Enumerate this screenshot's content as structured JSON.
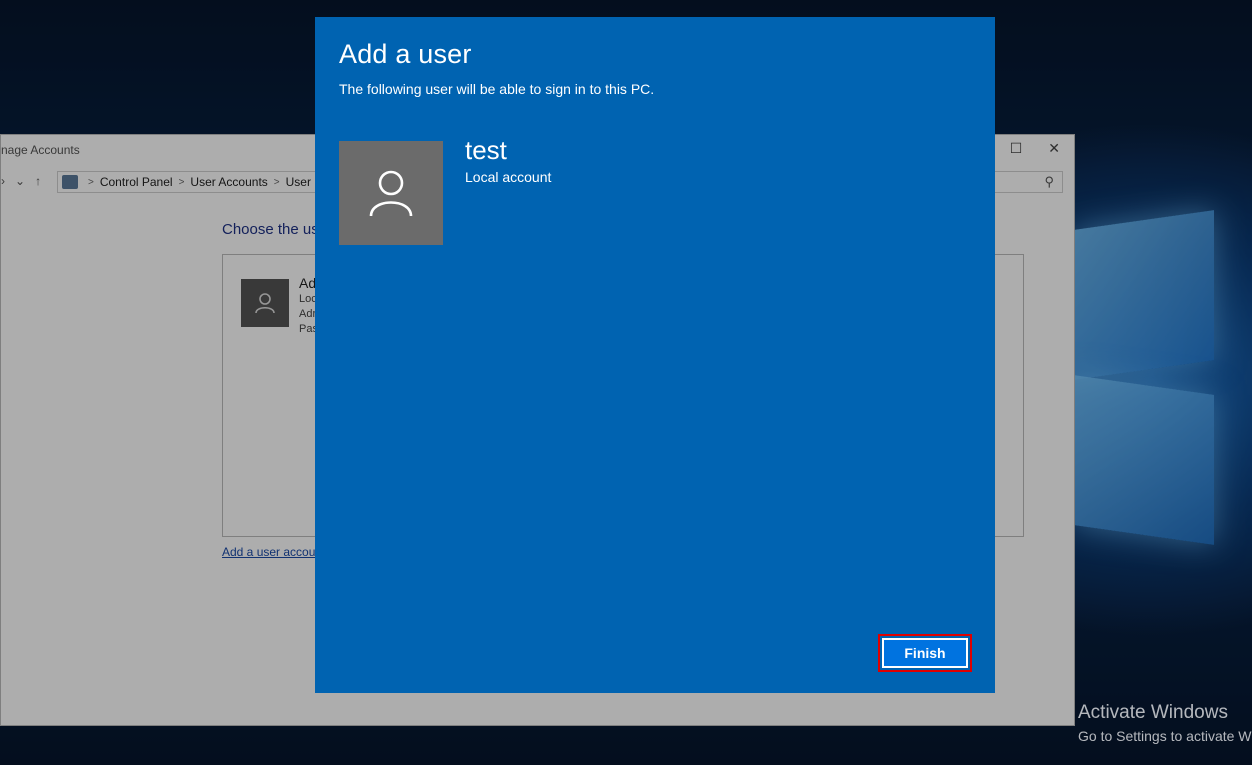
{
  "dialog": {
    "title": "Add a user",
    "subtitle": "The following user will be able to sign in to this PC.",
    "user": {
      "name": "test",
      "type": "Local account",
      "icon": "person-icon"
    },
    "finish_label": "Finish",
    "bg_color": "#0063b1"
  },
  "background_window": {
    "title": "nage Accounts",
    "breadcrumbs": [
      "Control Panel",
      "User Accounts",
      "User"
    ],
    "heading": "Choose the us",
    "user_entry": {
      "name": "Ad",
      "lines": [
        "Loc",
        "Adr",
        "Pas"
      ]
    },
    "add_user_link": "Add a user accoun"
  },
  "watermark": {
    "line1": "Activate Windows",
    "line2": "Go to Settings to activate W"
  }
}
